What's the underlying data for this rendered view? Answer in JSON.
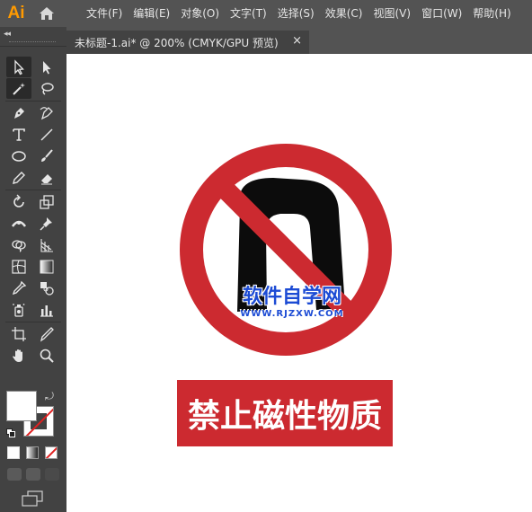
{
  "app": {
    "logo_text": "Ai",
    "menus": [
      "文件(F)",
      "编辑(E)",
      "对象(O)",
      "文字(T)",
      "选择(S)",
      "效果(C)",
      "视图(V)",
      "窗口(W)",
      "帮助(H)"
    ]
  },
  "tab": {
    "title": "未标题-1.ai* @ 200% (CMYK/GPU 预览)",
    "close": "×"
  },
  "tools": {
    "collapse": "◂◂",
    "more": "•••",
    "items": [
      "selection-tool",
      "direct-selection-tool",
      "magic-wand-tool",
      "lasso-tool",
      "pen-tool",
      "curvature-tool",
      "type-tool",
      "line-tool",
      "ellipse-tool",
      "paintbrush-tool",
      "shaper-tool",
      "eraser-tool",
      "rotate-tool",
      "scale-tool",
      "width-tool",
      "puppet-warp-tool",
      "shape-builder-tool",
      "perspective-grid-tool",
      "mesh-tool",
      "gradient-tool",
      "eyedropper-tool",
      "blend-tool",
      "symbol-sprayer-tool",
      "column-graph-tool",
      "artboard-tool",
      "slice-tool",
      "hand-tool",
      "zoom-tool"
    ]
  },
  "colors": {
    "sign_red": "#cc2a30",
    "sign_black": "#0c0c0c",
    "watermark_blue": "#1c4bd4",
    "logo_orange": "#ff9a00"
  },
  "artwork": {
    "watermark_title": "软件自学网",
    "watermark_url": "WWW.RJZXW.COM",
    "label": "禁止磁性物质"
  }
}
